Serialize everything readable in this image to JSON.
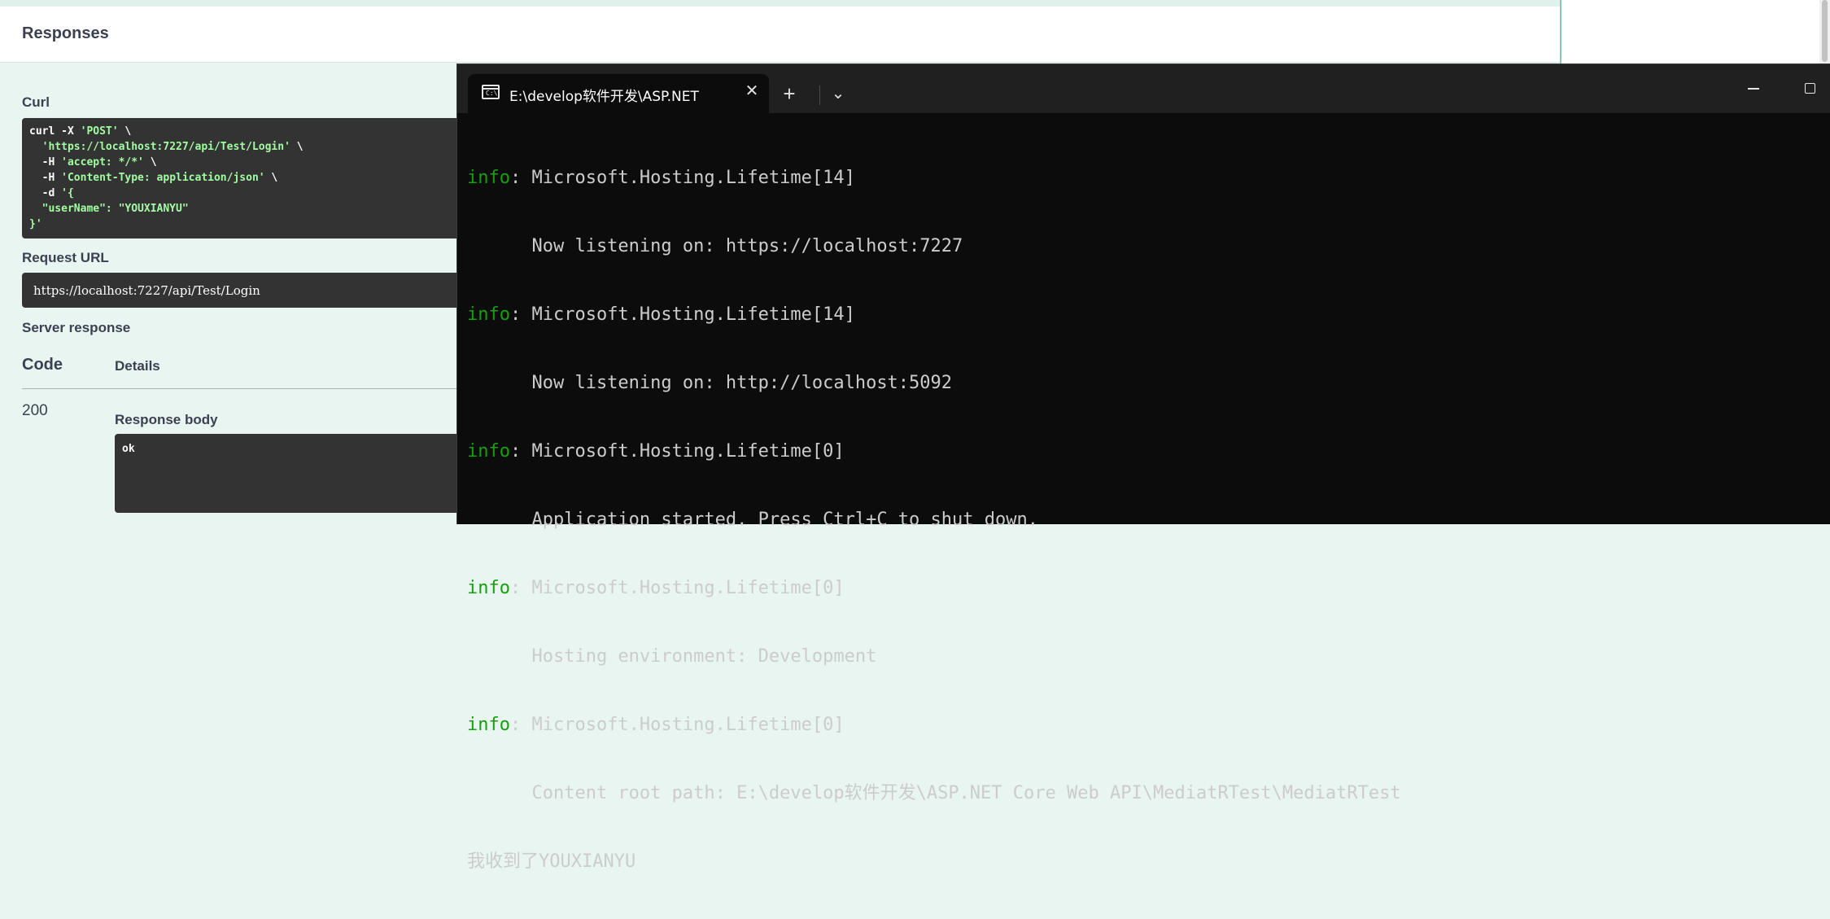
{
  "swagger": {
    "section_title": "Responses",
    "curl_label": "Curl",
    "curl_lines": [
      {
        "plain": "curl -X ",
        "str": "'POST'",
        "tail": " \\"
      },
      {
        "plain": "  ",
        "str": "'https://localhost:7227/api/Test/Login'",
        "tail": " \\"
      },
      {
        "plain": "  -H ",
        "str": "'accept: */*'",
        "tail": " \\"
      },
      {
        "plain": "  -H ",
        "str": "'Content-Type: application/json'",
        "tail": " \\"
      },
      {
        "plain": "  -d ",
        "str": "'{",
        "tail": ""
      },
      {
        "plain": "",
        "str": "  \"userName\": \"YOUXIANYU\"",
        "tail": ""
      },
      {
        "plain": "",
        "str": "}'",
        "tail": ""
      }
    ],
    "request_url_label": "Request URL",
    "request_url": "https://localhost:7227/api/Test/Login",
    "server_response_label": "Server response",
    "code_header": "Code",
    "details_header": "Details",
    "response_code": "200",
    "response_body_label": "Response body",
    "response_body": "ok"
  },
  "terminal": {
    "tab_title": "E:\\develop软件开发\\ASP.NET",
    "tab_icon_text": "C:\\",
    "new_tab_glyph": "+",
    "dropdown_glyph": "⌄",
    "close_glyph": "✕",
    "lines": [
      {
        "level": "info",
        "text": ": Microsoft.Hosting.Lifetime[14]"
      },
      {
        "level": "",
        "text": "      Now listening on: https://localhost:7227"
      },
      {
        "level": "info",
        "text": ": Microsoft.Hosting.Lifetime[14]"
      },
      {
        "level": "",
        "text": "      Now listening on: http://localhost:5092"
      },
      {
        "level": "info",
        "text": ": Microsoft.Hosting.Lifetime[0]"
      },
      {
        "level": "",
        "text": "      Application started. Press Ctrl+C to shut down."
      },
      {
        "level": "info",
        "text": ": Microsoft.Hosting.Lifetime[0]"
      },
      {
        "level": "",
        "text": "      Hosting environment: Development"
      },
      {
        "level": "info",
        "text": ": Microsoft.Hosting.Lifetime[0]"
      },
      {
        "level": "",
        "text": "      Content root path: E:\\develop软件开发\\ASP.NET Core Web API\\MediatRTest\\MediatRTest"
      },
      {
        "level": "",
        "text": "我收到了YOUXIANYU"
      }
    ]
  },
  "colors": {
    "info_green": "#13a10e",
    "curl_string_green": "#a2fca2",
    "swagger_bg": "#e9f5f0"
  }
}
